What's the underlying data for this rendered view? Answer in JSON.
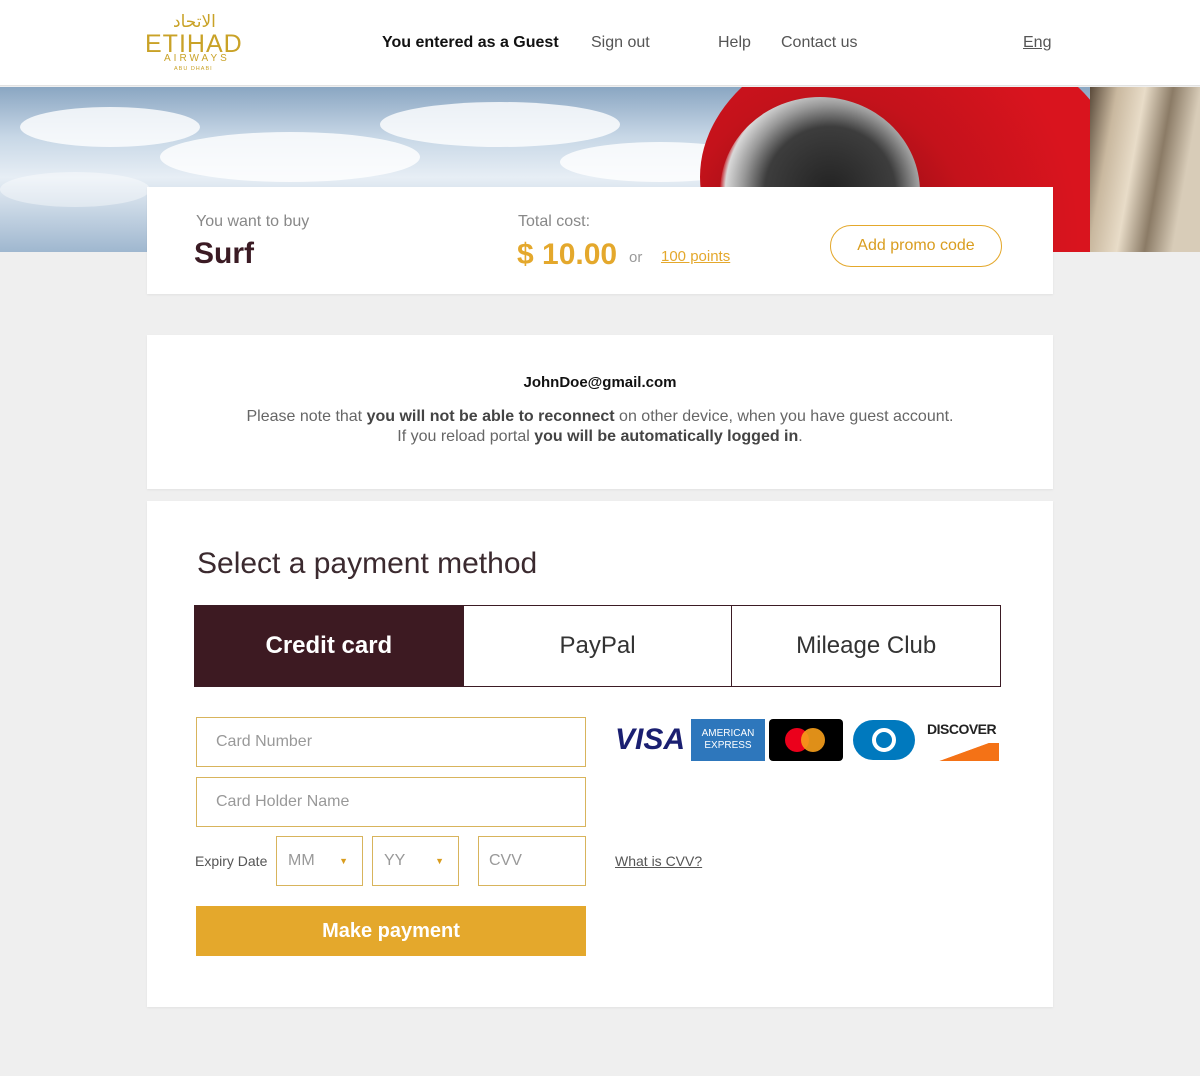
{
  "header": {
    "logo": {
      "arabic": "الاتحاد",
      "name": "ETIHAD",
      "sub": "AIRWAYS",
      "city": "ABU DHABI"
    },
    "guest_text": "You entered as a Guest",
    "sign_out": "Sign out",
    "help": "Help",
    "contact": "Contact us",
    "language": "Eng"
  },
  "product": {
    "label": "You want to buy",
    "name": "Surf",
    "total_label": "Total cost:",
    "price": "$ 10.00",
    "or": "or",
    "points": "100 points",
    "promo_button": "Add promo code"
  },
  "notice": {
    "email": "JohnDoe@gmail.com",
    "line1_a": "Please note that ",
    "line1_b": "you will not be able to reconnect",
    "line1_c": " on other device, when you have guest account.",
    "line2_a": "If you reload portal ",
    "line2_b": "you will be automatically logged in",
    "line2_c": "."
  },
  "payment": {
    "title": "Select a payment method",
    "tabs": [
      "Credit card",
      "PayPal",
      "Mileage Club"
    ],
    "active_tab": "Credit card",
    "card_number_placeholder": "Card Number",
    "card_holder_placeholder": "Card Holder Name",
    "expiry_label": "Expiry Date",
    "month_placeholder": "MM",
    "year_placeholder": "YY",
    "cvv_placeholder": "CVV",
    "what_cvv": "What is CVV?",
    "submit": "Make payment",
    "card_logos": {
      "visa": "VISA",
      "amex_1": "AMERICAN",
      "amex_2": "EXPRESS",
      "discover": "DISCOVER"
    }
  },
  "colors": {
    "brand_gold": "#e4a82c",
    "brand_dark": "#3d1a22",
    "background": "#efefef"
  }
}
